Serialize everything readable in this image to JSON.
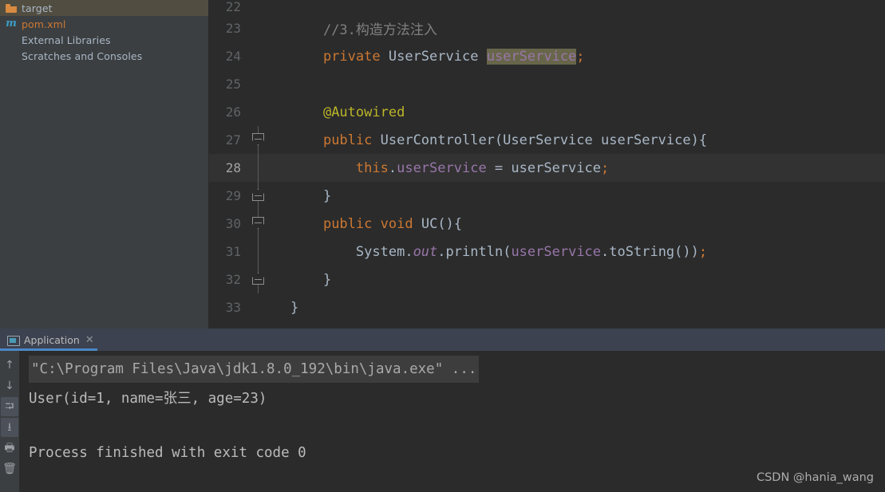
{
  "project_panel": {
    "items": [
      {
        "label": "target",
        "icon": "folder-icon",
        "selected": true,
        "style": "folder"
      },
      {
        "label": "pom.xml",
        "icon": "maven-icon",
        "selected": false,
        "style": "pom",
        "icon_glyph": "m"
      },
      {
        "label": "External Libraries",
        "icon": "library-icon",
        "selected": false,
        "style": "plain"
      },
      {
        "label": "Scratches and Consoles",
        "icon": "scratches-icon",
        "selected": false,
        "style": "plain"
      }
    ]
  },
  "editor": {
    "lines": [
      {
        "num": "22",
        "fold": "none",
        "clipped": true,
        "caret": false,
        "tokens": []
      },
      {
        "num": "23",
        "fold": "none",
        "clipped": false,
        "caret": false,
        "tokens": [
          {
            "t": "    ",
            "c": "t-punct"
          },
          {
            "t": "//3.构造方法注入",
            "c": "t-comment"
          }
        ]
      },
      {
        "num": "24",
        "fold": "none",
        "clipped": false,
        "caret": false,
        "tokens": [
          {
            "t": "    ",
            "c": "t-punct"
          },
          {
            "t": "private",
            "c": "t-kw"
          },
          {
            "t": " ",
            "c": "t-punct"
          },
          {
            "t": "UserService",
            "c": "t-type"
          },
          {
            "t": " ",
            "c": "t-punct"
          },
          {
            "t": "userService",
            "c": "hl-ident"
          },
          {
            "t": ";",
            "c": "t-kw"
          }
        ]
      },
      {
        "num": "25",
        "fold": "none",
        "clipped": false,
        "caret": false,
        "tokens": []
      },
      {
        "num": "26",
        "fold": "none",
        "clipped": false,
        "caret": false,
        "tokens": [
          {
            "t": "    ",
            "c": "t-punct"
          },
          {
            "t": "@Autowired",
            "c": "t-anno"
          }
        ]
      },
      {
        "num": "27",
        "fold": "open",
        "clipped": false,
        "caret": false,
        "tokens": [
          {
            "t": "    ",
            "c": "t-punct"
          },
          {
            "t": "public",
            "c": "t-kw"
          },
          {
            "t": " ",
            "c": "t-punct"
          },
          {
            "t": "UserController",
            "c": "t-type"
          },
          {
            "t": "(",
            "c": "t-punct"
          },
          {
            "t": "UserService",
            "c": "t-type"
          },
          {
            "t": " ",
            "c": "t-punct"
          },
          {
            "t": "userService",
            "c": "t-ident"
          },
          {
            "t": "){",
            "c": "t-punct"
          }
        ]
      },
      {
        "num": "28",
        "fold": "bar",
        "clipped": false,
        "caret": true,
        "tokens": [
          {
            "t": "        ",
            "c": "t-punct"
          },
          {
            "t": "this",
            "c": "t-kw"
          },
          {
            "t": ".",
            "c": "t-punct"
          },
          {
            "t": "userService",
            "c": "t-field"
          },
          {
            "t": " = ",
            "c": "t-punct"
          },
          {
            "t": "userService",
            "c": "t-ident"
          },
          {
            "t": ";",
            "c": "t-kw"
          }
        ]
      },
      {
        "num": "29",
        "fold": "end",
        "clipped": false,
        "caret": false,
        "tokens": [
          {
            "t": "    }",
            "c": "t-punct"
          }
        ]
      },
      {
        "num": "30",
        "fold": "open",
        "clipped": false,
        "caret": false,
        "tokens": [
          {
            "t": "    ",
            "c": "t-punct"
          },
          {
            "t": "public",
            "c": "t-kw"
          },
          {
            "t": " ",
            "c": "t-punct"
          },
          {
            "t": "void",
            "c": "t-kw"
          },
          {
            "t": " ",
            "c": "t-punct"
          },
          {
            "t": "UC",
            "c": "t-method"
          },
          {
            "t": "(){",
            "c": "t-punct"
          }
        ]
      },
      {
        "num": "31",
        "fold": "bar",
        "clipped": false,
        "caret": false,
        "tokens": [
          {
            "t": "        ",
            "c": "t-punct"
          },
          {
            "t": "System",
            "c": "t-type"
          },
          {
            "t": ".",
            "c": "t-punct"
          },
          {
            "t": "out",
            "c": "t-static"
          },
          {
            "t": ".",
            "c": "t-punct"
          },
          {
            "t": "println",
            "c": "t-method"
          },
          {
            "t": "(",
            "c": "t-punct"
          },
          {
            "t": "userService",
            "c": "t-field"
          },
          {
            "t": ".",
            "c": "t-punct"
          },
          {
            "t": "toString",
            "c": "t-method"
          },
          {
            "t": "())",
            "c": "t-punct"
          },
          {
            "t": ";",
            "c": "t-kw"
          }
        ]
      },
      {
        "num": "32",
        "fold": "end",
        "clipped": false,
        "caret": false,
        "tokens": [
          {
            "t": "    }",
            "c": "t-punct"
          }
        ]
      },
      {
        "num": "33",
        "fold": "none",
        "clipped": false,
        "caret": false,
        "tokens": [
          {
            "t": "}",
            "c": "t-punct"
          }
        ]
      }
    ]
  },
  "tabbar": {
    "tab_label": "Application",
    "close_glyph": "✕"
  },
  "console": {
    "toolbar_buttons": [
      {
        "name": "scroll-up-button",
        "glyph": "↑",
        "boxed": false
      },
      {
        "name": "scroll-down-button",
        "glyph": "↓",
        "boxed": false
      },
      {
        "name": "soft-wrap-button",
        "glyph": "⮒",
        "boxed": true
      },
      {
        "name": "scroll-to-end-button",
        "glyph": "⭳",
        "boxed": true
      },
      {
        "name": "print-button",
        "glyph": "🖶",
        "boxed": false
      },
      {
        "name": "clear-all-button",
        "glyph": "🗑",
        "boxed": false
      }
    ],
    "lines": [
      {
        "text": "\"C:\\Program Files\\Java\\jdk1.8.0_192\\bin\\java.exe\" ...",
        "style": "cmd"
      },
      {
        "text": "User(id=1, name=张三, age=23)",
        "style": "out"
      },
      {
        "text": "",
        "style": "blank"
      },
      {
        "text": "Process finished with exit code 0",
        "style": "out"
      }
    ]
  },
  "watermark": {
    "text": "CSDN @hania_wang"
  },
  "colors": {
    "editor_bg": "#2b2b2b",
    "panel_bg": "#3c3f41",
    "caret_line": "#323232",
    "selection": "#514d40",
    "tabbar_bg": "#3c424f",
    "tab_underline": "#4a88c7",
    "keyword": "#cc7832",
    "field": "#9876aa",
    "annotation": "#bbb529",
    "comment": "#808080",
    "text": "#a9b7c6",
    "highlight_bg": "#68664a"
  }
}
